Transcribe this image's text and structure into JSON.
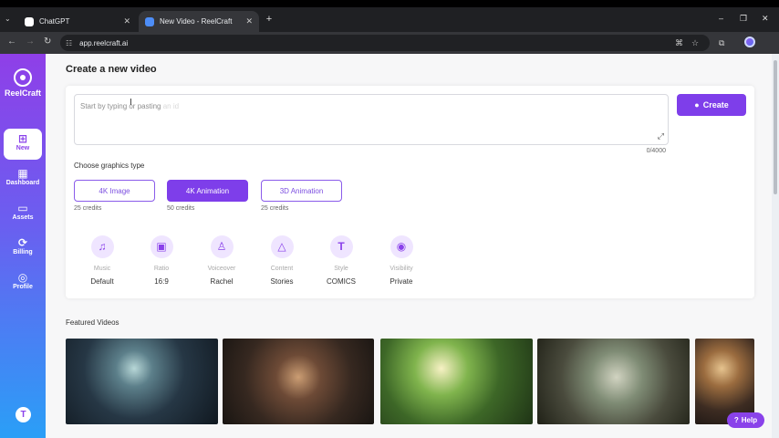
{
  "browser": {
    "tabs": [
      {
        "title": "ChatGPT",
        "active": false,
        "favicon_color": "#ffffff"
      },
      {
        "title": "New Video - ReelCraft",
        "active": true,
        "favicon_color": "#4d8df7"
      }
    ],
    "url": "app.reelcraft.ai"
  },
  "sidebar": {
    "brand": "ReelCraft",
    "items": [
      {
        "label": "New",
        "icon": "plus-square-icon",
        "active": true
      },
      {
        "label": "Dashboard",
        "icon": "grid-icon",
        "active": false
      },
      {
        "label": "Assets",
        "icon": "folder-icon",
        "active": false
      },
      {
        "label": "Billing",
        "icon": "refresh-icon",
        "active": false
      },
      {
        "label": "Profile",
        "icon": "user-circle-icon",
        "active": false
      }
    ],
    "avatar_initial": "T"
  },
  "main": {
    "title": "Create a new video",
    "prompt": {
      "placeholder": "Start by typing or pasting ",
      "placeholder_faded": "an id",
      "counter": "0/4000",
      "create_label": "Create"
    },
    "graphics": {
      "heading": "Choose graphics type",
      "options": [
        {
          "label": "4K Image",
          "credits": "25 credits",
          "selected": false
        },
        {
          "label": "4K Animation",
          "credits": "50 credits",
          "selected": true
        },
        {
          "label": "3D Animation",
          "credits": "25 credits",
          "selected": false
        }
      ]
    },
    "settings": [
      {
        "label": "Music",
        "value": "Default",
        "icon": "music-note-icon"
      },
      {
        "label": "Ratio",
        "value": "16:9",
        "icon": "film-icon"
      },
      {
        "label": "Voiceover",
        "value": "Rachel",
        "icon": "microphone-icon"
      },
      {
        "label": "Content",
        "value": "Stories",
        "icon": "shapes-icon"
      },
      {
        "label": "Style",
        "value": "COMICS",
        "icon": "text-style-icon"
      },
      {
        "label": "Visibility",
        "value": "Private",
        "icon": "eye-icon"
      }
    ],
    "featured_heading": "Featured Videos",
    "help_label": "Help"
  },
  "colors": {
    "accent": "#7e3eea",
    "sidebar_top": "#8f3fe8",
    "sidebar_bottom": "#2a9ff7"
  }
}
